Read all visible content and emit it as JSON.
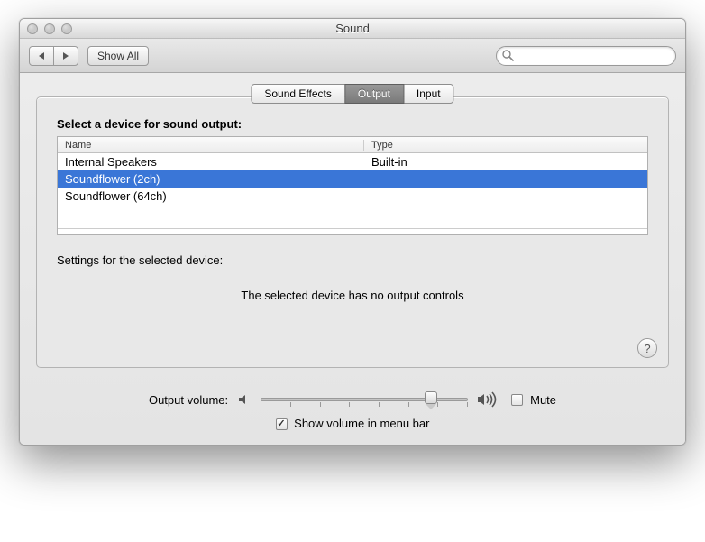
{
  "window": {
    "title": "Sound"
  },
  "toolbar": {
    "show_all": "Show All",
    "search_placeholder": ""
  },
  "tabs": [
    {
      "label": "Sound Effects",
      "active": false
    },
    {
      "label": "Output",
      "active": true
    },
    {
      "label": "Input",
      "active": false
    }
  ],
  "panel": {
    "select_label": "Select a device for sound output:",
    "columns": {
      "name": "Name",
      "type": "Type"
    },
    "devices": [
      {
        "name": "Internal Speakers",
        "type": "Built-in",
        "selected": false
      },
      {
        "name": "Soundflower (2ch)",
        "type": "",
        "selected": true
      },
      {
        "name": "Soundflower (64ch)",
        "type": "",
        "selected": false
      }
    ],
    "settings_label": "Settings for the selected device:",
    "no_controls": "The selected device has no output controls",
    "help": "?"
  },
  "volume": {
    "label": "Output volume:",
    "mute_label": "Mute",
    "mute_checked": false,
    "menubar_label": "Show volume in menu bar",
    "menubar_checked": true
  },
  "search_glyph": "Q"
}
